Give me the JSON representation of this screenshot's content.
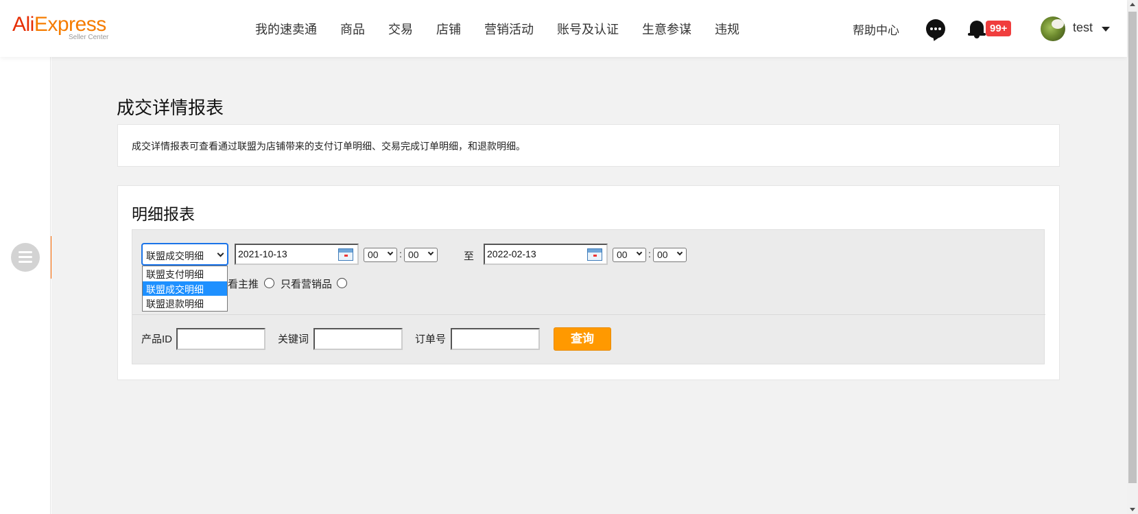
{
  "header": {
    "logo": {
      "brand_part1": "Ali",
      "brand_part2": "Express",
      "subtitle": "Seller Center"
    },
    "nav": [
      "我的速卖通",
      "商品",
      "交易",
      "店铺",
      "营销活动",
      "账号及认证",
      "生意参谋",
      "违规"
    ],
    "help": "帮助中心",
    "notifications_badge": "99+",
    "username": "test"
  },
  "page": {
    "title": "成交详情报表",
    "intro": "成交详情报表可查看通过联盟为店铺带来的支付订单明细、交易完成订单明细，和退款明细。"
  },
  "report": {
    "title": "明细报表",
    "type_select": {
      "selected": "联盟成交明细",
      "options": [
        "联盟支付明细",
        "联盟成交明细",
        "联盟退款明细"
      ]
    },
    "start_date": "2021-10-13",
    "start_hour": "00",
    "start_minute": "00",
    "to_label": "至",
    "end_date": "2022-02-13",
    "end_hour": "00",
    "end_minute": "00",
    "time_sep": ":",
    "radio_main": "看主推",
    "radio_marketing": "只看营销品",
    "product_id_label": "产品ID",
    "keyword_label": "关键词",
    "order_no_label": "订单号",
    "query_button": "查询"
  },
  "colors": {
    "accent_orange": "#ff9900",
    "sidebar_toggle": "#ff6a00",
    "badge_red": "#f03e3e",
    "selected_option": "#1e90ff",
    "page_bg": "#f2f2f2"
  }
}
